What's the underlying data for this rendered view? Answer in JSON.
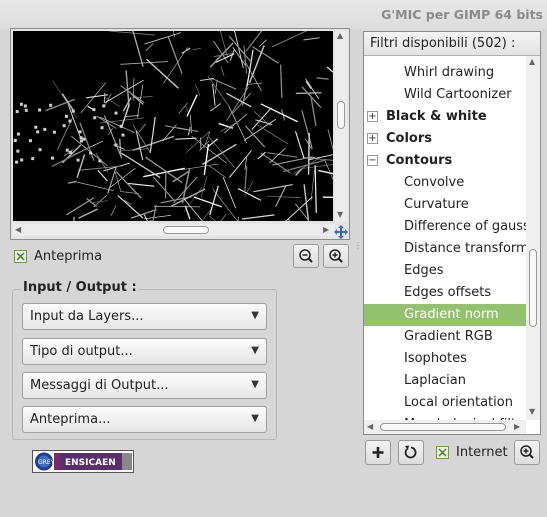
{
  "window": {
    "title": "G'MIC per GIMP 64 bits"
  },
  "preview": {
    "checkbox_label": "Anteprima",
    "checked": true
  },
  "io": {
    "title": "Input / Output :",
    "input_layers": "Input da Layers...",
    "output_type": "Tipo di output...",
    "output_messages": "Messaggi di Output...",
    "preview_mode": "Anteprima..."
  },
  "logo": {
    "text": "ENSICAEN",
    "small": "GREYC"
  },
  "filters": {
    "header": "Filtri disponibili (502) :",
    "items": [
      {
        "label": "Whirl drawing"
      },
      {
        "label": "Wild Cartoonizer"
      },
      {
        "label": "Black & white",
        "expander": "+"
      },
      {
        "label": "Colors",
        "expander": "+"
      },
      {
        "label": "Contours",
        "expander": "−"
      },
      {
        "label": "Convolve"
      },
      {
        "label": "Curvature"
      },
      {
        "label": "Difference of gaussians"
      },
      {
        "label": "Distance transform"
      },
      {
        "label": "Edges"
      },
      {
        "label": "Edges offsets"
      },
      {
        "label": "Gradient norm"
      },
      {
        "label": "Gradient RGB"
      },
      {
        "label": "Isophotes"
      },
      {
        "label": "Laplacian"
      },
      {
        "label": "Local orientation"
      },
      {
        "label": "Morphological filter"
      }
    ],
    "selected": "Gradient norm"
  },
  "bottom": {
    "internet_label": "Internet",
    "internet_checked": true
  }
}
